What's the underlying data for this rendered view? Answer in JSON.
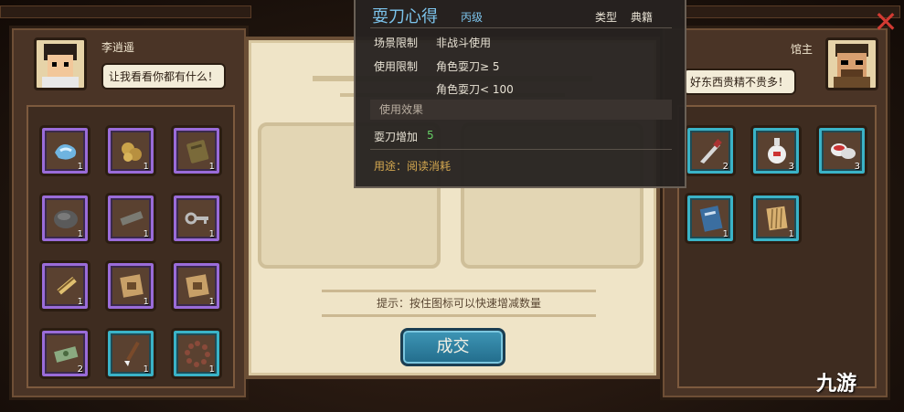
{
  "player": {
    "name": "李逍遥",
    "speech": "让我看看你都有什么！",
    "items": [
      {
        "name": "scarf",
        "count": "1"
      },
      {
        "name": "gold-nuggets",
        "count": "1"
      },
      {
        "name": "tablet",
        "count": "1"
      },
      {
        "name": "iron-ore",
        "count": "1"
      },
      {
        "name": "iron-bar",
        "count": "1"
      },
      {
        "name": "key",
        "count": "1"
      },
      {
        "name": "scroll",
        "count": "1"
      },
      {
        "name": "map",
        "count": "1"
      },
      {
        "name": "map",
        "count": "1"
      },
      {
        "name": "banknote",
        "count": "2"
      },
      {
        "name": "brush",
        "count": "1"
      },
      {
        "name": "prayer-beads",
        "count": "1"
      }
    ]
  },
  "shopkeeper": {
    "name": "馆主",
    "speech": "好东西贵精不贵多！"
  },
  "shop": {
    "items": [
      {
        "name": "dagger",
        "count": "2"
      },
      {
        "name": "wine-jar",
        "count": "3"
      },
      {
        "name": "rouge-box",
        "count": "3"
      },
      {
        "name": "book",
        "count": "1"
      },
      {
        "name": "bamboo-scroll",
        "count": "1"
      }
    ]
  },
  "trade": {
    "hint": "提示：按住图标可以快速增减数量",
    "deal_label": "成交"
  },
  "tooltip": {
    "name": "耍刀心得",
    "grade": "丙级",
    "type_label": "类型",
    "type_value": "典籍",
    "scene_label": "场景限制",
    "scene_value": "非战斗使用",
    "use_label": "使用限制",
    "use_value_1": "角色耍刀≥ 5",
    "use_value_2": "角色耍刀< 100",
    "effect_header": "使用效果",
    "effect_label": "耍刀增加",
    "effect_value": "5",
    "usage": "用途：阅读消耗"
  },
  "ui": {
    "close_glyph": "✕",
    "watermark": "九游"
  },
  "colors": {
    "slot_purple": "#9a6cd9",
    "slot_teal": "#3ab3c7",
    "tooltip_title": "#7cc4ec",
    "effect_value": "#66d066",
    "usage_text": "#d4a850",
    "close": "#d23a32"
  }
}
